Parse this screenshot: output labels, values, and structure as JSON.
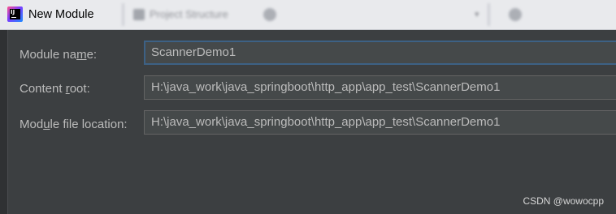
{
  "window": {
    "title": "New Module",
    "background_window": {
      "tab_label": "Project Structure"
    }
  },
  "form": {
    "module_name": {
      "label_parts": [
        "Module na",
        "m",
        "e:"
      ],
      "value": "ScannerDemo1"
    },
    "content_root": {
      "label_parts": [
        "Content ",
        "r",
        "oot:"
      ],
      "value": "H:\\java_work\\java_springboot\\http_app\\app_test\\ScannerDemo1"
    },
    "module_file_location": {
      "label_parts": [
        "Mod",
        "u",
        "le file location:"
      ],
      "value": "H:\\java_work\\java_springboot\\http_app\\app_test\\ScannerDemo1"
    }
  },
  "watermark": "CSDN @wowocpp",
  "icons": {
    "app": "intellij-idea-icon",
    "background": [
      "project-structure-icon",
      "gear-icon",
      "chevron-down-icon",
      "gear-icon"
    ]
  },
  "colors": {
    "dialog_bg": "#3c3f41",
    "label_text": "#bbbbbb",
    "input_bg": "#45494a",
    "focus_border": "#3d6185",
    "titlebar_bg": "#e9eaed"
  }
}
